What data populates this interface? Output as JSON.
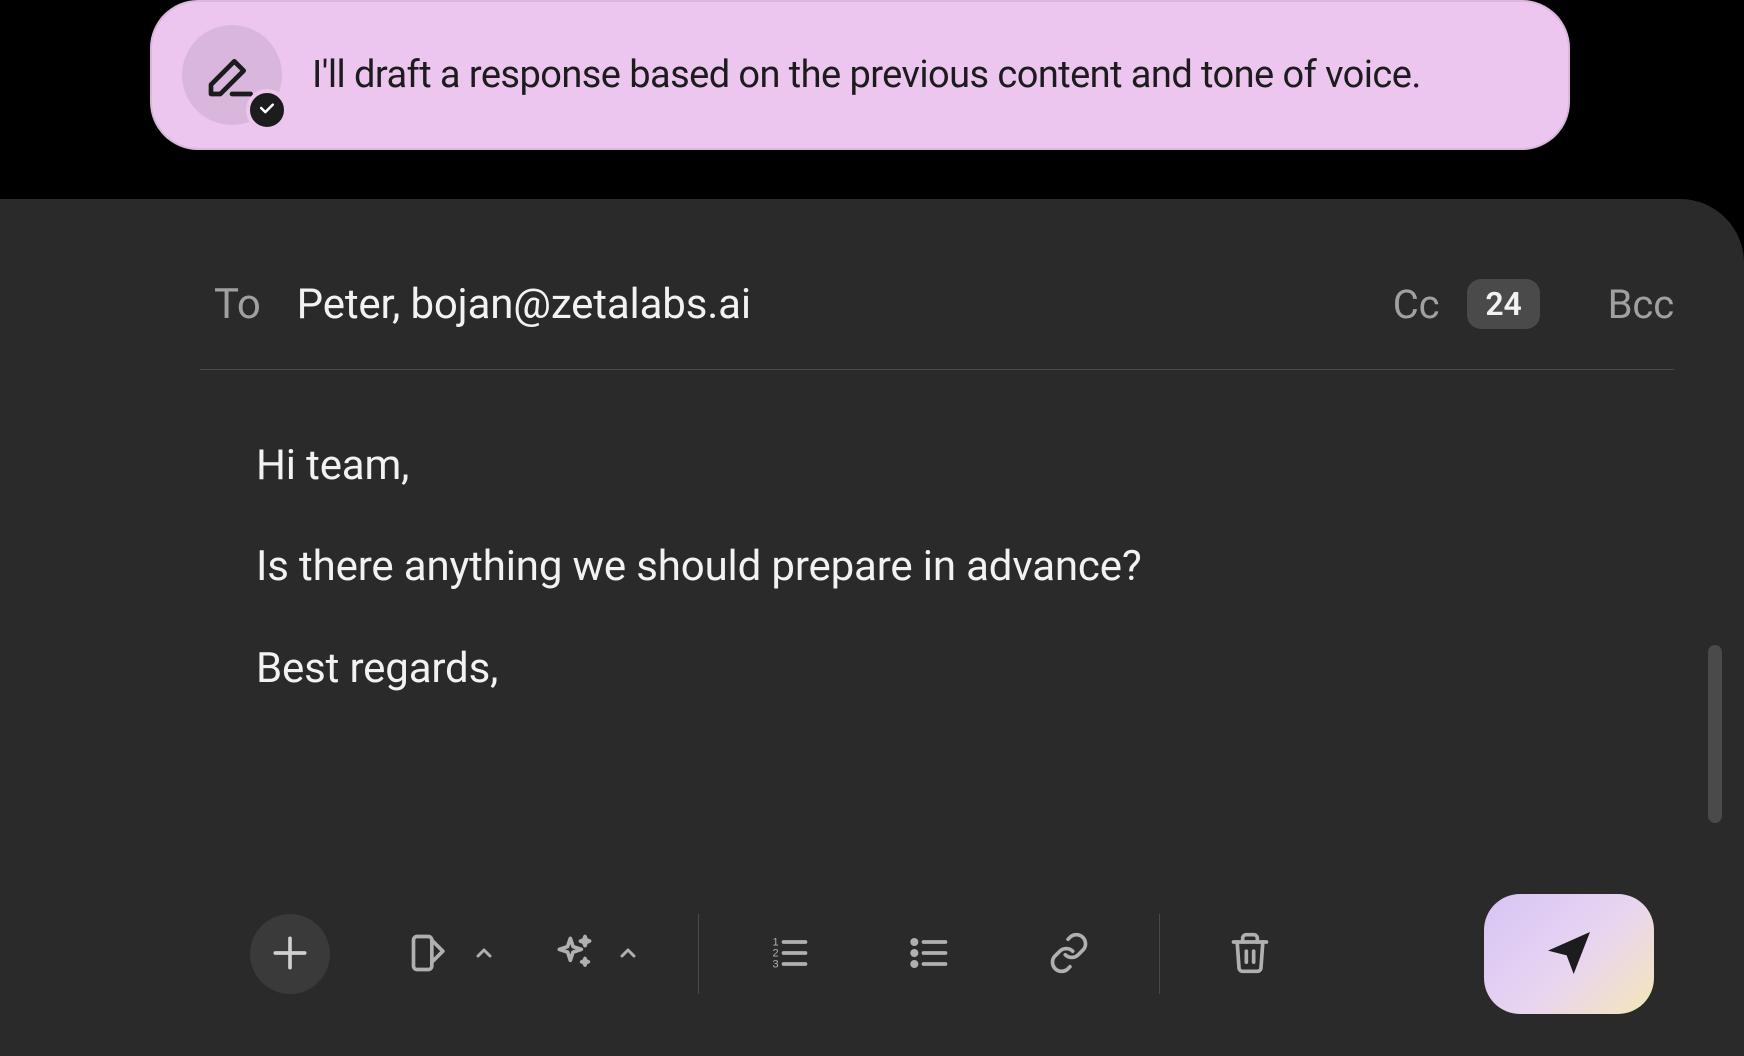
{
  "ai_banner": {
    "message": "I'll draft a response based on the previous content and tone of voice."
  },
  "compose": {
    "to_label": "To",
    "to_value": "Peter, bojan@zetalabs.ai",
    "cc_label": "Cc",
    "cc_count": "24",
    "bcc_label": "Bcc",
    "body": {
      "line1": "Hi team,",
      "line2": "Is there anything we should prepare in advance?",
      "line3": "Best regards,"
    }
  }
}
